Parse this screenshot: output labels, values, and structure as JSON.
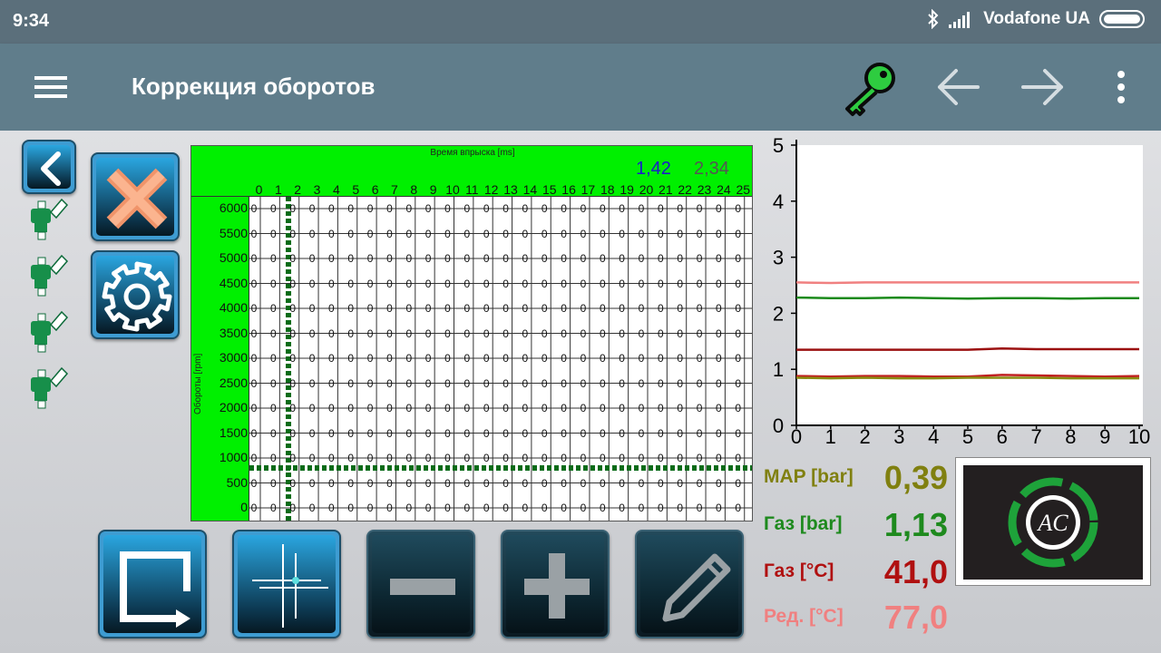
{
  "status": {
    "time": "9:34",
    "carrier": "Vodafone UA"
  },
  "app": {
    "title": "Коррекция оборотов"
  },
  "table": {
    "x_label": "Время впрыска [ms]",
    "y_label": "Обороты [rpm]",
    "value_blue": "1,42",
    "value_gray": "2,34",
    "columns": [
      "0",
      "1",
      "2",
      "3",
      "4",
      "5",
      "6",
      "7",
      "8",
      "9",
      "10",
      "11",
      "12",
      "13",
      "14",
      "15",
      "16",
      "17",
      "18",
      "19",
      "20",
      "21",
      "22",
      "23",
      "24",
      "25"
    ],
    "rows": [
      "6000",
      "5500",
      "5000",
      "4500",
      "4000",
      "3500",
      "3000",
      "2500",
      "2000",
      "1500",
      "1000",
      "500",
      "0"
    ],
    "cell_value": "0"
  },
  "chart_data": {
    "type": "line",
    "x_ticks": [
      "0",
      "1",
      "2",
      "3",
      "4",
      "5",
      "6",
      "7",
      "8",
      "9",
      "10"
    ],
    "y_ticks": [
      "0",
      "1",
      "2",
      "3",
      "4",
      "5"
    ],
    "xlim": [
      0,
      10
    ],
    "ylim": [
      0,
      5
    ],
    "series": [
      {
        "color": "#f08080",
        "values": [
          2.55,
          2.54,
          2.55,
          2.55,
          2.55,
          2.55,
          2.55,
          2.55,
          2.55,
          2.55,
          2.55
        ]
      },
      {
        "color": "#1a8a1a",
        "values": [
          2.28,
          2.27,
          2.27,
          2.28,
          2.27,
          2.26,
          2.27,
          2.27,
          2.26,
          2.27,
          2.27
        ]
      },
      {
        "color": "#9b1010",
        "values": [
          1.35,
          1.35,
          1.35,
          1.35,
          1.35,
          1.35,
          1.37,
          1.36,
          1.36,
          1.36,
          1.36
        ]
      },
      {
        "color": "#c02020",
        "values": [
          0.88,
          0.87,
          0.88,
          0.88,
          0.87,
          0.87,
          0.9,
          0.89,
          0.88,
          0.87,
          0.88
        ]
      },
      {
        "color": "#8a8a10",
        "values": [
          0.85,
          0.84,
          0.85,
          0.84,
          0.84,
          0.85,
          0.85,
          0.85,
          0.84,
          0.84,
          0.84
        ]
      }
    ]
  },
  "readouts": [
    {
      "label": "MAP [bar]",
      "value": "0,39",
      "color": "#808010"
    },
    {
      "label": "Газ [bar]",
      "value": "1,13",
      "color": "#1e8a1e"
    },
    {
      "label": "Газ [°C]",
      "value": "41,0",
      "color": "#b01010"
    },
    {
      "label": "Ред. [°C]",
      "value": "77,0",
      "color": "#f08080"
    }
  ]
}
